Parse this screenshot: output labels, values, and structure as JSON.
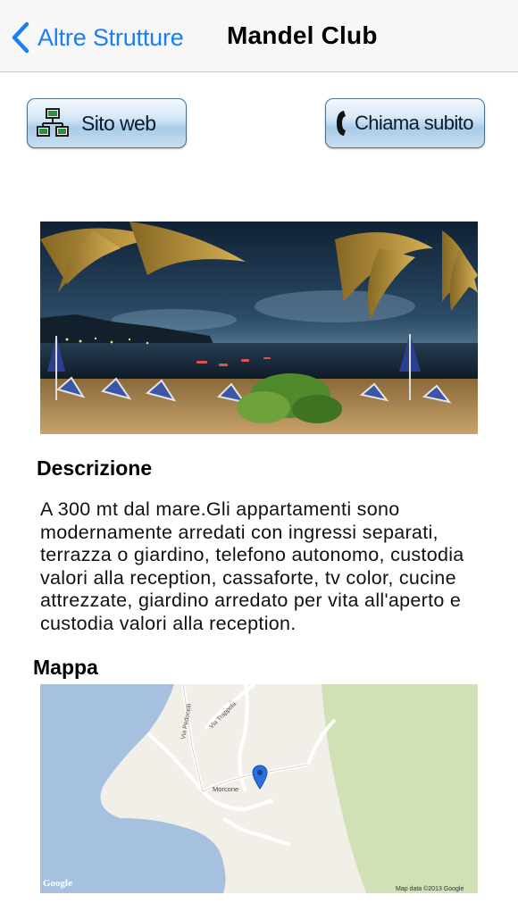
{
  "nav": {
    "back_label": "Altre Strutture",
    "title": "Mandel Club"
  },
  "actions": {
    "website_label": "Sito web",
    "call_label": "Chiama subito"
  },
  "description": {
    "title": "Descrizione",
    "text": "A 300 mt dal mare.Gli appartamenti sono modernamente arredati con ingressi separati, terrazza o giardino, telefono autonomo, custodia valori alla reception, cassaforte, tv color, cucine attrezzate, giardino arredato per vita all'aperto e custodia valori alla reception."
  },
  "map": {
    "title": "Mappa",
    "street_1": "Via Pedocelli",
    "street_2": "Via Trappola",
    "place": "Morcone",
    "logo": "Google",
    "attribution": "Map data ©2013 Google"
  },
  "colors": {
    "accent": "#1a7ef5",
    "water": "#a6c1e0",
    "park": "#cfe1b5",
    "land": "#f2efe9",
    "pin": "#2a6ee0"
  }
}
